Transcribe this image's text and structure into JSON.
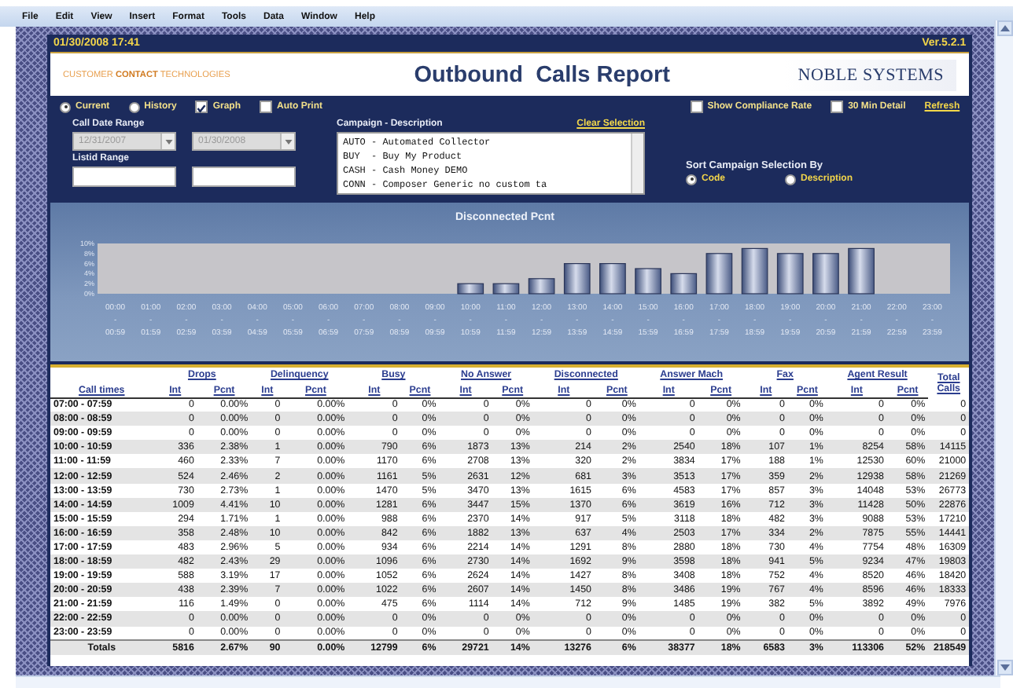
{
  "menu_bar": [
    "File",
    "Edit",
    "View",
    "Insert",
    "Format",
    "Tools",
    "Data",
    "Window",
    "Help"
  ],
  "header": {
    "timestamp": "01/30/2008 17:41",
    "version": "Ver.5.2.1",
    "tagline": "CUSTOMER **CONTACT** TECHNOLOGIES",
    "title": "Outbound  Calls Report",
    "logo": "NOBLE SYSTEMS"
  },
  "view_options": [
    {
      "label": "Current",
      "kind": "radio",
      "selected": true
    },
    {
      "label": "History",
      "kind": "radio",
      "selected": false
    },
    {
      "label": "Graph",
      "kind": "checkbox",
      "checked": true
    },
    {
      "label": "Auto Print",
      "kind": "checkbox",
      "checked": false
    }
  ],
  "detail_options": [
    {
      "label": "Show Compliance Rate",
      "checked": false
    },
    {
      "label": "30 Min Detail",
      "checked": false
    }
  ],
  "refresh_link": "Refresh",
  "call_date_range": {
    "label": "Call Date Range",
    "from": "12/31/2007",
    "to": "01/30/2008",
    "disabled": true
  },
  "listid_range": {
    "label": "Listid Range"
  },
  "campaign": {
    "label": "Campaign - Description",
    "clear_link": "Clear Selection",
    "items": [
      "AUTO - Automated Collector",
      "BUY  - Buy My Product",
      "CASH - Cash Money DEMO",
      "CONN - Composer Generic no custom ta"
    ]
  },
  "sort": {
    "label": "Sort Campaign Selection By",
    "options": [
      {
        "label": "Code",
        "selected": true
      },
      {
        "label": "Description",
        "selected": false
      }
    ]
  },
  "chart": {
    "chart_data": {
      "type": "bar",
      "title": "Disconnected Pcnt",
      "categories": [
        "00:00 - 00:59",
        "01:00 - 01:59",
        "02:00 - 02:59",
        "03:00 - 03:59",
        "04:00 - 04:59",
        "05:00 - 05:59",
        "06:00 - 06:59",
        "07:00 - 07:59",
        "08:00 - 08:59",
        "09:00 - 09:59",
        "10:00 - 10:59",
        "11:00 - 11:59",
        "12:00 - 12:59",
        "13:00 - 13:59",
        "14:00 - 14:59",
        "15:00 - 15:59",
        "16:00 - 16:59",
        "17:00 - 17:59",
        "18:00 - 18:59",
        "19:00 - 19:59",
        "20:00 - 20:59",
        "21:00 - 21:59",
        "22:00 - 22:59",
        "23:00 - 23:59"
      ],
      "values": [
        0,
        0,
        0,
        0,
        0,
        0,
        0,
        0,
        0,
        0,
        2,
        2,
        3,
        6,
        6,
        5,
        4,
        8,
        9,
        8,
        8,
        9,
        0,
        0
      ],
      "ylim": [
        0,
        10
      ],
      "yticks": [
        {
          "value": 0,
          "label": "0%"
        },
        {
          "value": 2,
          "label": "2%"
        },
        {
          "value": 4,
          "label": "4%"
        },
        {
          "value": 6,
          "label": "6%"
        },
        {
          "value": 8,
          "label": "8%"
        },
        {
          "value": 10,
          "label": "10%"
        }
      ]
    }
  },
  "table": {
    "time_heading": "Call times",
    "total_heading": "Total Calls",
    "groups": [
      {
        "label": "Drops",
        "sub_headings": [
          "Int",
          "Pcnt"
        ]
      },
      {
        "label": "Delinquency",
        "sub_headings": [
          "Int",
          "Pcnt"
        ]
      },
      {
        "label": "Busy",
        "sub_headings": [
          "Int",
          "Pcnt"
        ]
      },
      {
        "label": "No Answer",
        "sub_headings": [
          "Int",
          "Pcnt"
        ]
      },
      {
        "label": "Disconnected",
        "sub_headings": [
          "Int",
          "Pcnt"
        ]
      },
      {
        "label": "Answer Mach",
        "sub_headings": [
          "Int",
          "Pcnt"
        ]
      },
      {
        "label": "Fax",
        "sub_headings": [
          "Int",
          "Pcnt"
        ]
      },
      {
        "label": "Agent Result",
        "sub_headings": [
          "Int",
          "Pcnt"
        ]
      }
    ],
    "rows": [
      {
        "time": "07:00 - 07:59",
        "cells": [
          "0",
          "0.00%",
          "0",
          "0.00%",
          "0",
          "0%",
          "0",
          "0%",
          "0",
          "0%",
          "0",
          "0%",
          "0",
          "0%",
          "0",
          "0%",
          "0"
        ]
      },
      {
        "time": "08:00 - 08:59",
        "cells": [
          "0",
          "0.00%",
          "0",
          "0.00%",
          "0",
          "0%",
          "0",
          "0%",
          "0",
          "0%",
          "0",
          "0%",
          "0",
          "0%",
          "0",
          "0%",
          "0"
        ]
      },
      {
        "time": "09:00 - 09:59",
        "cells": [
          "0",
          "0.00%",
          "0",
          "0.00%",
          "0",
          "0%",
          "0",
          "0%",
          "0",
          "0%",
          "0",
          "0%",
          "0",
          "0%",
          "0",
          "0%",
          "0"
        ]
      },
      {
        "time": "10:00 - 10:59",
        "cells": [
          "336",
          "2.38%",
          "1",
          "0.00%",
          "790",
          "6%",
          "1873",
          "13%",
          "214",
          "2%",
          "2540",
          "18%",
          "107",
          "1%",
          "8254",
          "58%",
          "14115"
        ]
      },
      {
        "time": "11:00 - 11:59",
        "cells": [
          "460",
          "2.33%",
          "7",
          "0.00%",
          "1170",
          "6%",
          "2708",
          "13%",
          "320",
          "2%",
          "3834",
          "17%",
          "188",
          "1%",
          "12530",
          "60%",
          "21000"
        ]
      },
      {
        "time": "12:00 - 12:59",
        "cells": [
          "524",
          "2.46%",
          "2",
          "0.00%",
          "1161",
          "5%",
          "2631",
          "12%",
          "681",
          "3%",
          "3513",
          "17%",
          "359",
          "2%",
          "12938",
          "58%",
          "21269"
        ]
      },
      {
        "time": "13:00 - 13:59",
        "cells": [
          "730",
          "2.73%",
          "1",
          "0.00%",
          "1470",
          "5%",
          "3470",
          "13%",
          "1615",
          "6%",
          "4583",
          "17%",
          "857",
          "3%",
          "14048",
          "53%",
          "26773"
        ]
      },
      {
        "time": "14:00 - 14:59",
        "cells": [
          "1009",
          "4.41%",
          "10",
          "0.00%",
          "1281",
          "6%",
          "3447",
          "15%",
          "1370",
          "6%",
          "3619",
          "16%",
          "712",
          "3%",
          "11428",
          "50%",
          "22876"
        ]
      },
      {
        "time": "15:00 - 15:59",
        "cells": [
          "294",
          "1.71%",
          "1",
          "0.00%",
          "988",
          "6%",
          "2370",
          "14%",
          "917",
          "5%",
          "3118",
          "18%",
          "482",
          "3%",
          "9088",
          "53%",
          "17210"
        ]
      },
      {
        "time": "16:00 - 16:59",
        "cells": [
          "358",
          "2.48%",
          "10",
          "0.00%",
          "842",
          "6%",
          "1882",
          "13%",
          "637",
          "4%",
          "2503",
          "17%",
          "334",
          "2%",
          "7875",
          "55%",
          "14441"
        ]
      },
      {
        "time": "17:00 - 17:59",
        "cells": [
          "483",
          "2.96%",
          "5",
          "0.00%",
          "934",
          "6%",
          "2214",
          "14%",
          "1291",
          "8%",
          "2880",
          "18%",
          "730",
          "4%",
          "7754",
          "48%",
          "16309"
        ]
      },
      {
        "time": "18:00 - 18:59",
        "cells": [
          "482",
          "2.43%",
          "29",
          "0.00%",
          "1096",
          "6%",
          "2730",
          "14%",
          "1692",
          "9%",
          "3598",
          "18%",
          "941",
          "5%",
          "9234",
          "47%",
          "19803"
        ]
      },
      {
        "time": "19:00 - 19:59",
        "cells": [
          "588",
          "3.19%",
          "17",
          "0.00%",
          "1052",
          "6%",
          "2624",
          "14%",
          "1427",
          "8%",
          "3408",
          "18%",
          "752",
          "4%",
          "8520",
          "46%",
          "18420"
        ]
      },
      {
        "time": "20:00 - 20:59",
        "cells": [
          "438",
          "2.39%",
          "7",
          "0.00%",
          "1022",
          "6%",
          "2607",
          "14%",
          "1450",
          "8%",
          "3486",
          "19%",
          "767",
          "4%",
          "8596",
          "46%",
          "18333"
        ]
      },
      {
        "time": "21:00 - 21:59",
        "cells": [
          "116",
          "1.49%",
          "0",
          "0.00%",
          "475",
          "6%",
          "1114",
          "14%",
          "712",
          "9%",
          "1485",
          "19%",
          "382",
          "5%",
          "3892",
          "49%",
          "7976"
        ]
      },
      {
        "time": "22:00 - 22:59",
        "cells": [
          "0",
          "0.00%",
          "0",
          "0.00%",
          "0",
          "0%",
          "0",
          "0%",
          "0",
          "0%",
          "0",
          "0%",
          "0",
          "0%",
          "0",
          "0%",
          "0"
        ]
      },
      {
        "time": "23:00 - 23:59",
        "cells": [
          "0",
          "0.00%",
          "0",
          "0.00%",
          "0",
          "0%",
          "0",
          "0%",
          "0",
          "0%",
          "0",
          "0%",
          "0",
          "0%",
          "0",
          "0%",
          "0"
        ]
      }
    ],
    "totals": {
      "label": "Totals",
      "cells": [
        "5816",
        "2.67%",
        "90",
        "0.00%",
        "12799",
        "6%",
        "29721",
        "14%",
        "13276",
        "6%",
        "38377",
        "18%",
        "6583",
        "3%",
        "113306",
        "52%",
        "218549"
      ]
    }
  }
}
